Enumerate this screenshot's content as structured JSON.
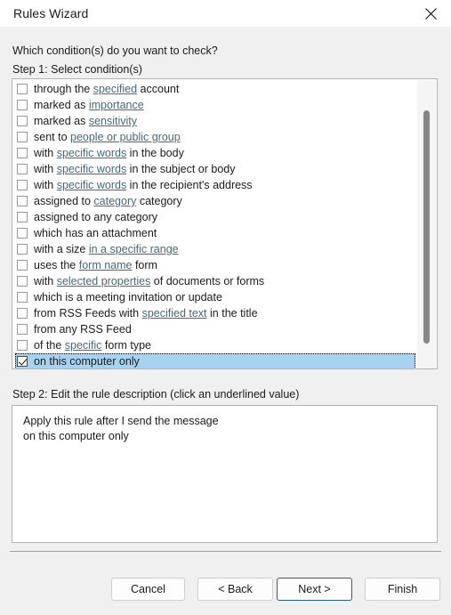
{
  "window": {
    "title": "Rules Wizard",
    "close_icon": "close-icon"
  },
  "main": {
    "question": "Which condition(s) do you want to check?",
    "step1_label": "Step 1: Select condition(s)",
    "step2_label": "Step 2: Edit the rule description (click an underlined value)"
  },
  "conditions": [
    {
      "checked": false,
      "parts": [
        {
          "t": "through the ",
          "link": false
        },
        {
          "t": "specified",
          "link": true
        },
        {
          "t": " account",
          "link": false
        }
      ]
    },
    {
      "checked": false,
      "parts": [
        {
          "t": "marked as ",
          "link": false
        },
        {
          "t": "importance",
          "link": true
        }
      ]
    },
    {
      "checked": false,
      "parts": [
        {
          "t": "marked as ",
          "link": false
        },
        {
          "t": "sensitivity",
          "link": true
        }
      ]
    },
    {
      "checked": false,
      "parts": [
        {
          "t": "sent to ",
          "link": false
        },
        {
          "t": "people or public group",
          "link": true
        }
      ]
    },
    {
      "checked": false,
      "parts": [
        {
          "t": "with ",
          "link": false
        },
        {
          "t": "specific words",
          "link": true
        },
        {
          "t": " in the body",
          "link": false
        }
      ]
    },
    {
      "checked": false,
      "parts": [
        {
          "t": "with ",
          "link": false
        },
        {
          "t": "specific words",
          "link": true
        },
        {
          "t": " in the subject or body",
          "link": false
        }
      ]
    },
    {
      "checked": false,
      "parts": [
        {
          "t": "with ",
          "link": false
        },
        {
          "t": "specific words",
          "link": true
        },
        {
          "t": " in the recipient's address",
          "link": false
        }
      ]
    },
    {
      "checked": false,
      "parts": [
        {
          "t": "assigned to ",
          "link": false
        },
        {
          "t": "category",
          "link": true
        },
        {
          "t": " category",
          "link": false
        }
      ]
    },
    {
      "checked": false,
      "parts": [
        {
          "t": "assigned to any category",
          "link": false
        }
      ]
    },
    {
      "checked": false,
      "parts": [
        {
          "t": "which has an attachment",
          "link": false
        }
      ]
    },
    {
      "checked": false,
      "parts": [
        {
          "t": "with a size ",
          "link": false
        },
        {
          "t": "in a specific range",
          "link": true
        }
      ]
    },
    {
      "checked": false,
      "parts": [
        {
          "t": "uses the ",
          "link": false
        },
        {
          "t": "form name",
          "link": true
        },
        {
          "t": " form",
          "link": false
        }
      ]
    },
    {
      "checked": false,
      "parts": [
        {
          "t": "with ",
          "link": false
        },
        {
          "t": "selected properties",
          "link": true
        },
        {
          "t": " of documents or forms",
          "link": false
        }
      ]
    },
    {
      "checked": false,
      "parts": [
        {
          "t": "which is a meeting invitation or update",
          "link": false
        }
      ]
    },
    {
      "checked": false,
      "parts": [
        {
          "t": "from RSS Feeds with ",
          "link": false
        },
        {
          "t": "specified text",
          "link": true
        },
        {
          "t": " in the title",
          "link": false
        }
      ]
    },
    {
      "checked": false,
      "parts": [
        {
          "t": "from any RSS Feed",
          "link": false
        }
      ]
    },
    {
      "checked": false,
      "parts": [
        {
          "t": "of the ",
          "link": false
        },
        {
          "t": "specific",
          "link": true
        },
        {
          "t": " form type",
          "link": false
        }
      ]
    },
    {
      "checked": true,
      "selected": true,
      "parts": [
        {
          "t": "on this computer only",
          "link": false
        }
      ]
    }
  ],
  "description": {
    "lines": [
      "Apply this rule after I send the message",
      "on this computer only"
    ]
  },
  "footer": {
    "cancel_label": "Cancel",
    "back_label": "< Back",
    "next_label": "Next >",
    "finish_label": "Finish"
  },
  "colors": {
    "selection": "#a8d3f0",
    "link": "#3f6b86",
    "default_button_border": "#2c6378",
    "panel": "#f0f0f0"
  }
}
